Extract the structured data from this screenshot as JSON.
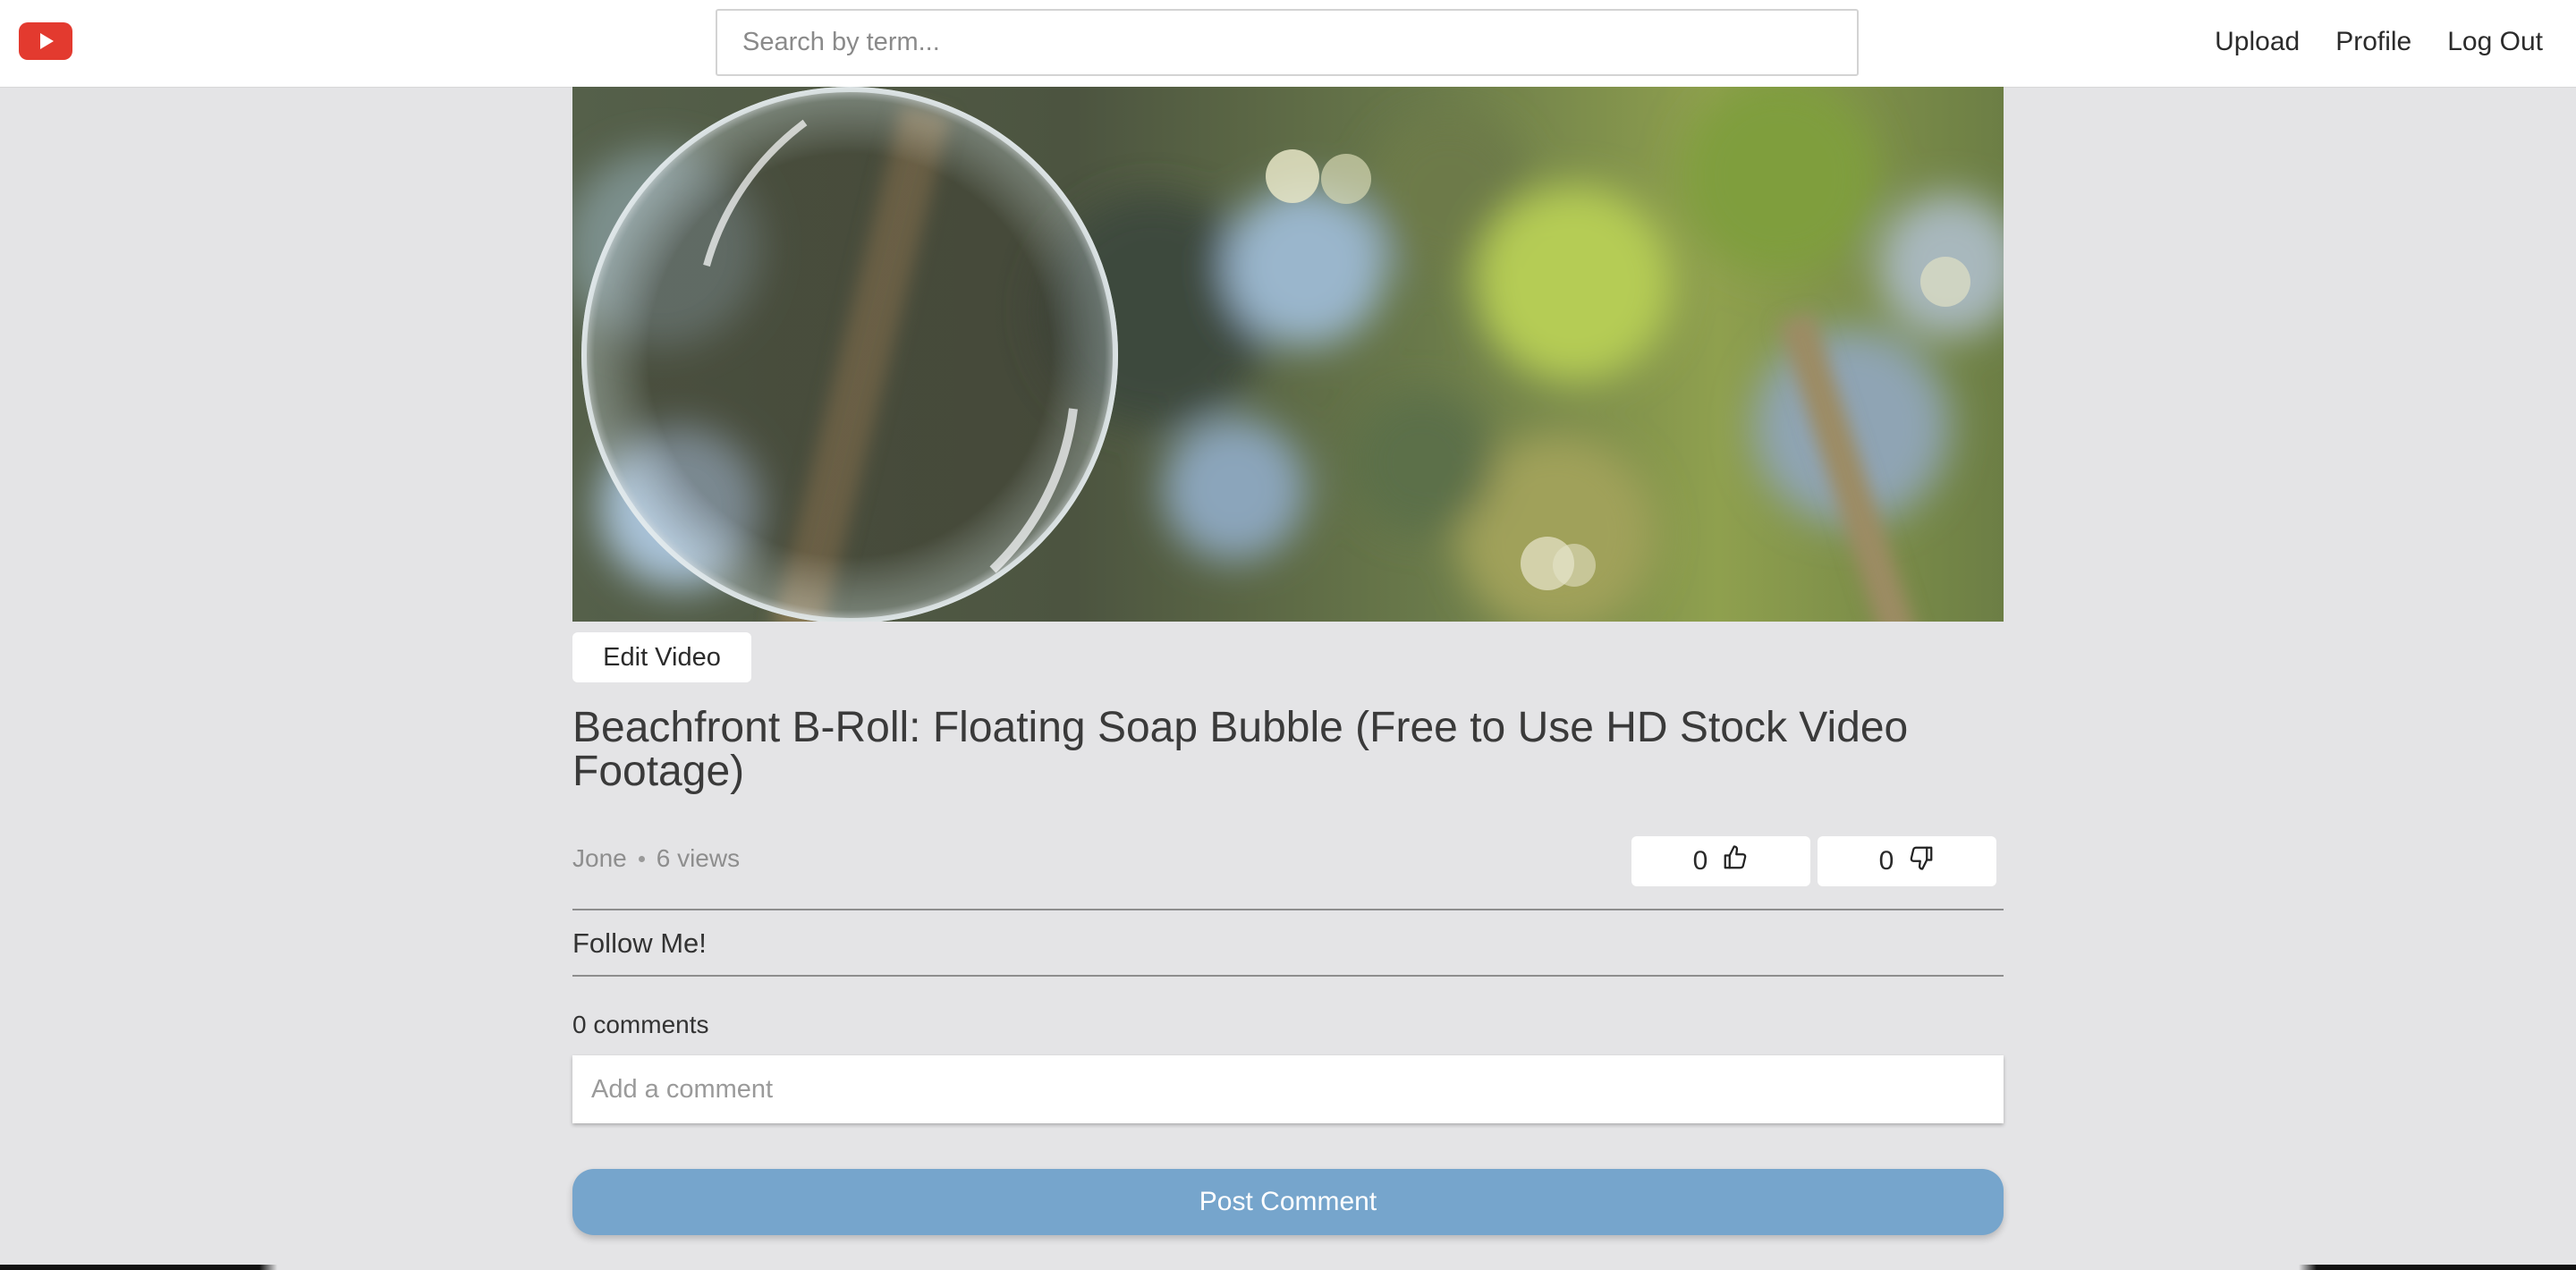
{
  "header": {
    "logo_icon": "youtube-play-icon",
    "brand_color": "#e33a2f",
    "search_placeholder": "Search by term...",
    "nav": {
      "upload": "Upload",
      "profile": "Profile",
      "logout": "Log Out"
    }
  },
  "video": {
    "thumbnail_description_icon": "video-player",
    "edit_label": "Edit Video",
    "title": "Beachfront B-Roll: Floating Soap Bubble (Free to Use HD Stock Video Footage)",
    "author": "Jone",
    "views": "6 views",
    "likes": "0",
    "dislikes": "0",
    "like_icon": "thumbs-up-icon",
    "dislike_icon": "thumbs-down-icon",
    "description": "Follow Me!"
  },
  "comments": {
    "count_label": "0 comments",
    "input_placeholder": "Add a comment",
    "post_label": "Post Comment",
    "post_color": "#76a5cc"
  }
}
